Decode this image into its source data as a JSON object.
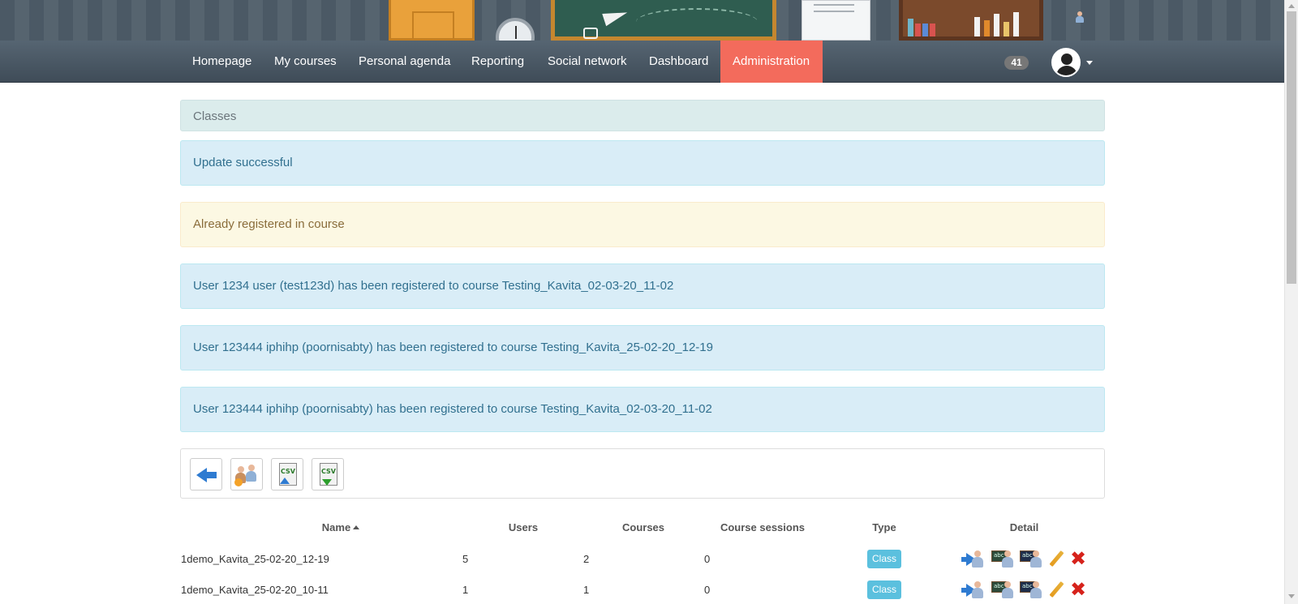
{
  "nav": {
    "items": [
      {
        "label": "Homepage"
      },
      {
        "label": "My courses"
      },
      {
        "label": "Personal agenda"
      },
      {
        "label": "Reporting"
      },
      {
        "label": "Social network"
      },
      {
        "label": "Dashboard"
      },
      {
        "label": "Administration",
        "active": true
      }
    ],
    "notification_count": "41"
  },
  "breadcrumb": "Classes",
  "messages": [
    {
      "type": "info",
      "text": "Update successful"
    },
    {
      "type": "warning",
      "text": "Already registered in course"
    },
    {
      "type": "info",
      "text": "User 1234 user (test123d) has been registered to course Testing_Kavita_02-03-20_11-02"
    },
    {
      "type": "info",
      "text": "User 123444 iphihp (poornisabty) has been registered to course Testing_Kavita_25-02-20_12-19"
    },
    {
      "type": "info",
      "text": "User 123444 iphihp (poornisabty) has been registered to course Testing_Kavita_02-03-20_11-02"
    }
  ],
  "toolbar": {
    "buttons": [
      "back-icon",
      "add-class-icon",
      "import-csv-icon",
      "export-csv-icon"
    ]
  },
  "table": {
    "headers": [
      "Name",
      "Users",
      "Courses",
      "Course sessions",
      "Type",
      "Detail"
    ],
    "sorted_by": "Name",
    "rows": [
      {
        "name": "1demo_Kavita_25-02-20_12-19",
        "users": "5",
        "courses": "2",
        "sessions": "0",
        "type": "Class"
      },
      {
        "name": "1demo_Kavita_25-02-20_10-11",
        "users": "1",
        "courses": "1",
        "sessions": "0",
        "type": "Class"
      }
    ]
  },
  "colors": {
    "navbar": "#4a5763",
    "active_tab": "#f36b5c",
    "info_bg": "#d9edf7",
    "info_text": "#31708f",
    "warning_bg": "#fcf8e3",
    "warning_text": "#8a6d3b",
    "type_badge": "#5bc0de"
  }
}
